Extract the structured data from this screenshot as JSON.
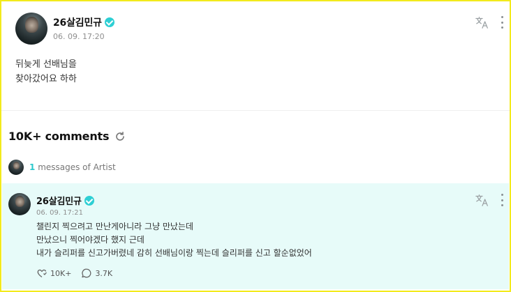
{
  "post": {
    "author": "26살김민규",
    "date": "06. 09. 17:20",
    "body_line1": "뒤늦게 선배님을",
    "body_line2": "찾아갔어요 하하"
  },
  "comments_header": {
    "count_label": "10K+ comments"
  },
  "artist_messages": {
    "count": "1",
    "label": "messages of Artist"
  },
  "comment": {
    "author": "26살김민규",
    "date": "06. 09. 17:21",
    "line1": "챌린지 찍으려고 만난게아니라 그냥 만났는데",
    "line2": "만났으니 찍어야겠다 했지 근데",
    "line3": "내가 슬리퍼를 신고가버렸네 감히 선배님이랑 찍는데 슬리퍼를 신고 할순없었어",
    "likes": "10K+",
    "replies": "3.7K"
  },
  "colors": {
    "accent": "#2cc8cc",
    "comment_bg": "#e7fbf9",
    "frame_border": "#f3ea1c"
  },
  "icons": [
    "verified-badge-icon",
    "translate-icon",
    "more-options-icon",
    "refresh-icon",
    "like-icon",
    "reply-icon"
  ]
}
